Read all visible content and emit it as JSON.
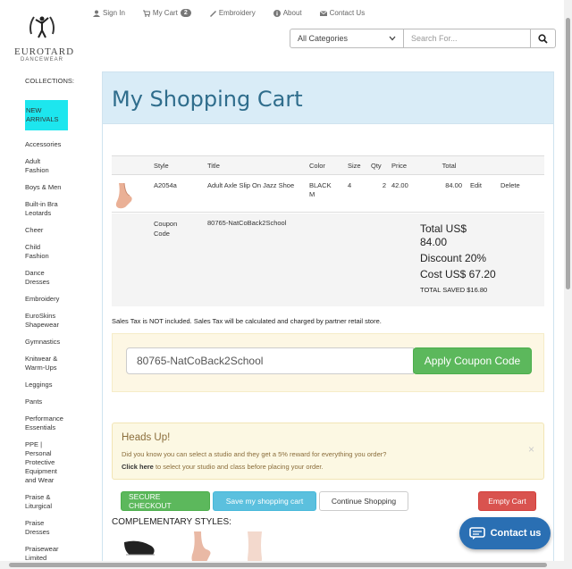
{
  "brand": {
    "line1": "EUROTARD",
    "line2": "DANCEWEAR"
  },
  "topnav": {
    "sign_in": "Sign In",
    "my_cart": "My Cart",
    "cart_count": "2",
    "embroidery": "Embroidery",
    "about": "About",
    "contact": "Contact Us"
  },
  "search": {
    "category": "All Categories",
    "placeholder": "Search For..."
  },
  "sidebar": {
    "heading": "COLLECTIONS:",
    "items": [
      "NEW ARRIVALS",
      "Accessories",
      "Adult Fashion",
      "Boys & Men",
      "Built-in Bra Leotards",
      "Cheer",
      "Child Fashion",
      "Dance Dresses",
      "Embroidery",
      "EuroSkins Shapewear",
      "Gymnastics",
      "Knitwear & Warm-Ups",
      "Leggings",
      "Pants",
      "Performance Essentials",
      "PPE | Personal Protective Equipment and Wear",
      "Praise & Liturgical",
      "Praise Dresses",
      "Praisewear Limited Edition"
    ]
  },
  "page": {
    "title": "My Shopping Cart"
  },
  "table": {
    "headers": {
      "style": "Style",
      "title": "Title",
      "color": "Color",
      "size": "Size",
      "qty": "Qty",
      "price": "Price",
      "total": "Total"
    },
    "row": {
      "style": "A2054a",
      "title": "Adult Axle Slip On Jazz Shoe",
      "color": "BLACK M",
      "size": "4",
      "qty": "2",
      "price": "42.00",
      "total": "84.00",
      "edit": "Edit",
      "delete": "Delete"
    }
  },
  "coupon_summary": {
    "label": "Coupon Code",
    "code": "80765-NatCoBack2School",
    "total": "Total US$ 84.00",
    "discount": "Discount 20%",
    "cost": "Cost US$ 67.20",
    "saved": "TOTAL SAVED $16.80"
  },
  "tax_note": "Sales Tax is NOT included. Sales Tax will be calculated and charged by partner retail store.",
  "coupon_form": {
    "value": "80765-NatCoBack2School",
    "apply_label": "Apply Coupon Code"
  },
  "alert": {
    "title": "Heads Up!",
    "line1": "Did you know you can select a studio and they get a 5% reward for everything you order?",
    "link": "Click here",
    "line2": " to select your studio and class before placing your order.",
    "close": "×"
  },
  "buttons": {
    "checkout": "SECURE CHECKOUT",
    "save": "Save my shopping cart",
    "continue": "Continue Shopping",
    "empty": "Empty Cart"
  },
  "complementary": {
    "title": "COMPLEMENTARY STYLES:"
  },
  "contact_widget": {
    "label": "Contact us"
  },
  "colors": {
    "accent_green": "#5cb85c",
    "accent_blue": "#5bc0de",
    "danger": "#d9534f",
    "highlight": "#1de6ee",
    "header_bg": "#d9ecf7",
    "contact_bg": "#2a6fb3"
  }
}
